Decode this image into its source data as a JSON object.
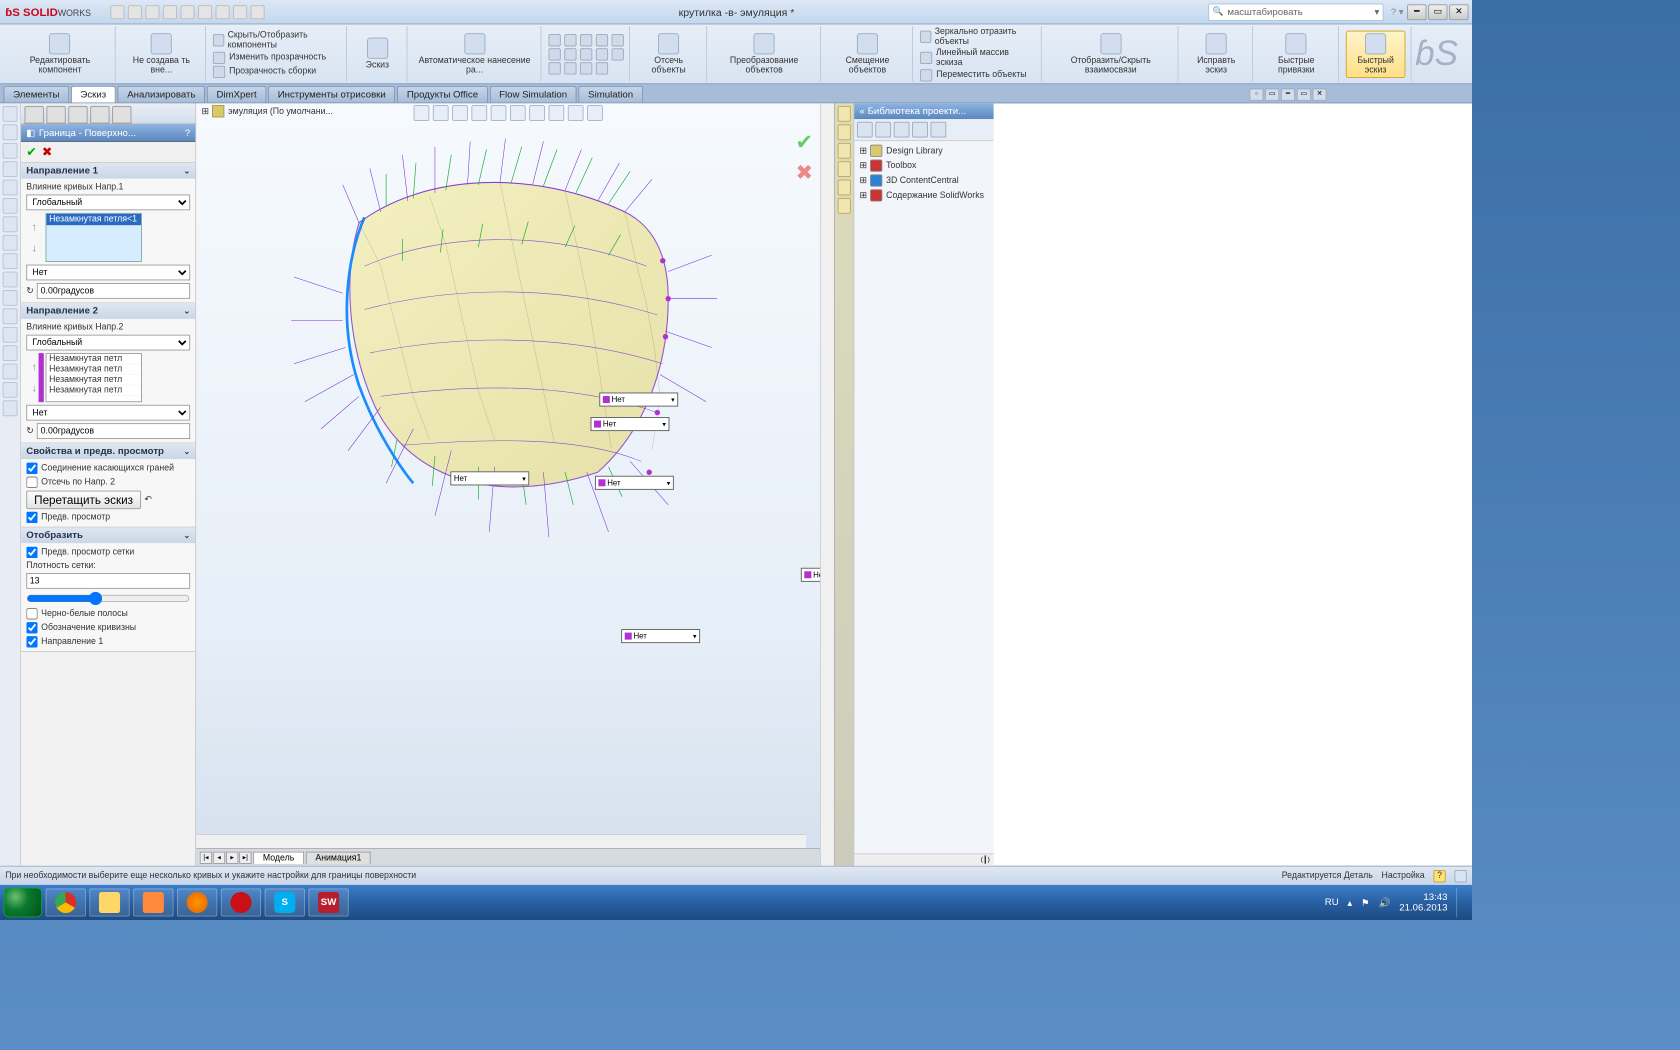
{
  "titlebar": {
    "brand_prefix": "S",
    "brand": "SOLID",
    "brand_suffix": "WORKS",
    "doc_title": "крутилка -в- эмуляция *",
    "search_placeholder": "масштабировать"
  },
  "ribbon": {
    "edit_component": "Редактировать компонент",
    "no_create_ext": "Не создава ть вне...",
    "hide_show_components": "Скрыть/Отобразить компоненты",
    "change_transparency": "Изменить прозрачность",
    "assembly_transparency": "Прозрачность сборки",
    "sketch": "Эскиз",
    "auto_dimension": "Автоматическое нанесение ра...",
    "trim_objects": "Отсечь объекты",
    "convert_objects": "Преобразование объектов",
    "offset_objects": "Смещение объектов",
    "mirror": "Зеркально отразить объекты",
    "linear_pattern": "Линейный массив эскиза",
    "move_objects": "Переместить объекты",
    "show_hide_relations": "Отобразить/Скрыть взаимосвязи",
    "repair_sketch": "Исправть эскиз",
    "quick_snaps": "Быстрые привязки",
    "rapid_sketch": "Быстрый эскиз"
  },
  "tabs": [
    "Элементы",
    "Эскиз",
    "Анализировать",
    "DimXpert",
    "Инструменты отрисовки",
    "Продукты Office",
    "Flow Simulation",
    "Simulation"
  ],
  "active_tab": "Эскиз",
  "viewport": {
    "feature_path": "эмуляция  (По умолчани...",
    "inline_option": "Нет"
  },
  "bottom_tabs": {
    "model": "Модель",
    "anim": "Анимация1"
  },
  "property_manager": {
    "title": "Граница - Поверхно...",
    "dir1": {
      "head": "Направление 1",
      "curve_influence": "Влияние кривых Напр.1",
      "global": "Глобальный",
      "none": "Нет",
      "item": "Незамкнутая петля<1",
      "angle": "0.00градусов"
    },
    "dir2": {
      "head": "Направление 2",
      "curve_influence": "Влияние кривых Напр.2",
      "global": "Глобальный",
      "none": "Нет",
      "item1": "Незамкнутая петл",
      "item2": "Незамкнутая петл",
      "item3": "Незамкнутая петл",
      "item4": "Незамкнутая петл",
      "angle": "0.00градусов"
    },
    "props": {
      "head": "Свойства и предв. просмотр",
      "merge_tangent": "Соединение касающихся граней",
      "trim_dir2": "Отсечь по Напр. 2",
      "drag_sketch": "Перетащить эскиз",
      "preview": "Предв. просмотр"
    },
    "display": {
      "head": "Отобразить",
      "mesh_preview": "Предв. просмотр сетки",
      "mesh_density": "Плотность сетки:",
      "density_value": "13",
      "zebra": "Черно-белые полосы",
      "curvature": "Обозначение кривизны",
      "dir1_chk": "Направление 1"
    }
  },
  "design_library": {
    "title": "« Библиотека проекти...",
    "items": [
      "Design Library",
      "Toolbox",
      "3D ContentCentral",
      "Содержание SolidWorks"
    ]
  },
  "statusbar": {
    "hint": "При необходимости выберите еще несколько кривых и укажите настройки для границы поверхности",
    "mode": "Редактируется Деталь",
    "custom": "Настройка"
  },
  "tray": {
    "lang": "RU",
    "time": "13:43",
    "date": "21.06.2013"
  }
}
